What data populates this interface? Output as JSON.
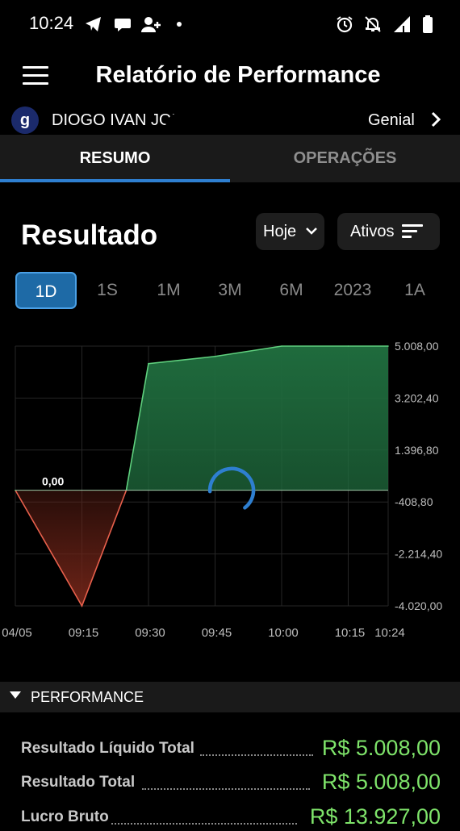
{
  "status_bar": {
    "time": "10:24",
    "left_icons": [
      "telegram-icon",
      "chat-icon",
      "add-user-icon",
      "dot-icon"
    ],
    "right_icons": [
      "alarm-icon",
      "bell-off-icon",
      "signal-icon",
      "battery-icon"
    ]
  },
  "app_bar": {
    "title": "Relatório de Performance"
  },
  "account": {
    "logo_letter": "g",
    "name": "DIOGO IVAN JORGE",
    "broker": "Genial"
  },
  "tabs": [
    {
      "label": "RESUMO",
      "active": true
    },
    {
      "label": "OPERAÇÕES",
      "active": false
    }
  ],
  "result": {
    "title": "Resultado",
    "date_filter": "Hoje",
    "assets_filter": "Ativos"
  },
  "periods": [
    {
      "label": "1D",
      "active": true
    },
    {
      "label": "1S",
      "active": false
    },
    {
      "label": "1M",
      "active": false
    },
    {
      "label": "3M",
      "active": false
    },
    {
      "label": "6M",
      "active": false
    },
    {
      "label": "2023",
      "active": false
    },
    {
      "label": "1A",
      "active": false
    }
  ],
  "colors": {
    "accent": "#2e7fd0",
    "positive": "#7ee36a",
    "negative": "#e8604c",
    "positive_fill": "#1f6b3d",
    "negative_fill": "#6e2418"
  },
  "chart_data": {
    "type": "area",
    "x": [
      "09:00",
      "09:15",
      "09:30",
      "09:45",
      "10:00",
      "10:15",
      "10:24"
    ],
    "x_tick_labels": [
      "04/05",
      "09:15",
      "09:30",
      "09:45",
      "10:00",
      "10:15",
      "10:24"
    ],
    "series": [
      {
        "values": [
          0,
          -4020,
          4400,
          4650,
          5008,
          5008,
          5008
        ]
      }
    ],
    "zero_crossing_x": "09:25",
    "y_tick_labels": [
      "5.008,00",
      "3.202,40",
      "1.396,80",
      "-408,80",
      "-2.214,40",
      "-4.020,00"
    ],
    "ylim": [
      -4020,
      5008
    ],
    "annotation": {
      "x": "09:00",
      "y": 0,
      "text": "0,00"
    },
    "grid": true,
    "loading_spinner": true
  },
  "performance": {
    "title": "PERFORMANCE",
    "rows": [
      {
        "label": "Resultado Líquido Total",
        "value": "R$ 5.008,00"
      },
      {
        "label": "Resultado Total",
        "value": "R$ 5.008,00"
      },
      {
        "label": "Lucro Bruto",
        "value": "R$ 13.927,00"
      }
    ]
  }
}
